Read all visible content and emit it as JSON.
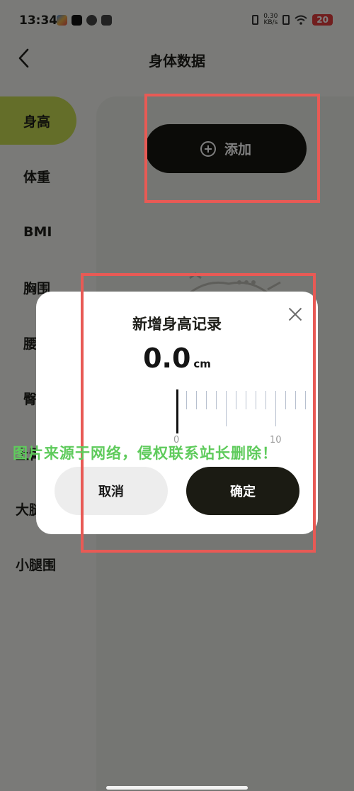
{
  "status_bar": {
    "time": "13:34",
    "net_speed_value": "0.30",
    "net_speed_unit": "KB/s",
    "battery": "20"
  },
  "header": {
    "title": "身体数据"
  },
  "sidebar": {
    "items": [
      {
        "label": "身高"
      },
      {
        "label": "体重"
      },
      {
        "label": "BMI"
      },
      {
        "label": "胸围"
      },
      {
        "label": "腰围"
      },
      {
        "label": "臀围"
      },
      {
        "label": "上臂围"
      },
      {
        "label": "大腿围"
      },
      {
        "label": "小腿围"
      }
    ],
    "active_index": 0
  },
  "main": {
    "add_button_label": "添加"
  },
  "dialog": {
    "title": "新增身高记录",
    "value": "0.0",
    "unit": "cm",
    "ruler_labels": [
      "0",
      "10"
    ],
    "cancel_label": "取消",
    "confirm_label": "确定"
  },
  "watermark": {
    "text": "图片来源于网络，侵权联系站长删除！"
  },
  "colors": {
    "accent": "#c9dc52",
    "dark_button": "#171710",
    "annotation": "#e85a55",
    "watermark": "#5fcb5c"
  }
}
